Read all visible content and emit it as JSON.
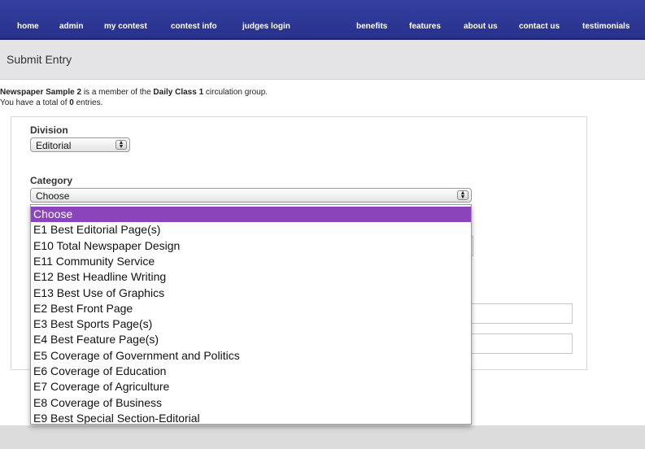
{
  "nav": {
    "left": [
      "home",
      "admin",
      "my contest",
      "contest info",
      "judges login"
    ],
    "right": [
      "benefits",
      "features",
      "about us",
      "contact us",
      "testimonials"
    ]
  },
  "page": {
    "title": "Submit Entry"
  },
  "info": {
    "line1_prefix": "Newspaper Sample 2",
    "line1_mid": " is a member of the ",
    "line1_group": "Daily Class 1",
    "line1_suffix": " circulation group.",
    "line2_prefix": "You have a total of ",
    "line2_count": "0",
    "line2_suffix": " entries."
  },
  "form": {
    "division_label": "Division",
    "division_value": "Editorial",
    "category_label": "Category",
    "category_value": "Choose"
  },
  "dropdown": {
    "selected_index": 0,
    "options": [
      "Choose",
      "E1 Best Editorial Page(s)",
      "E10 Total Newspaper Design",
      "E11 Community Service",
      "E12 Best Headline Writing",
      "E13 Best Use of Graphics",
      "E2 Best Front Page",
      "E3 Best Sports Page(s)",
      "E4 Best Feature Page(s)",
      "E5 Coverage of Government and Politics",
      "E6 Coverage of Education",
      "E7 Coverage of Agriculture",
      "E8 Coverage of Business",
      "E9 Best Special Section-Editorial"
    ]
  },
  "colors": {
    "nav_bg": "#2f3a9a",
    "highlight": "#8c44ba",
    "titlebar_bg": "#e4e4e6"
  }
}
